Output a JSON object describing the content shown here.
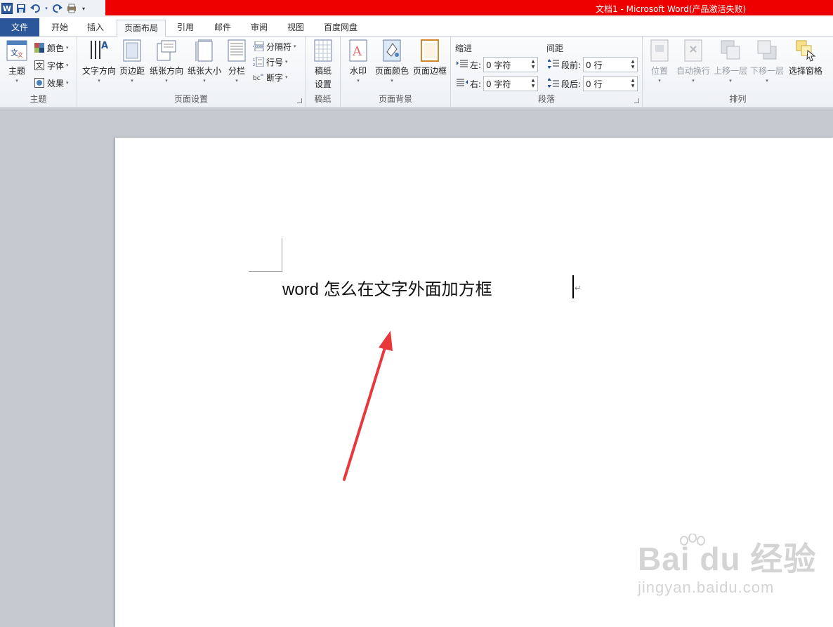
{
  "titlebar": {
    "title": "文档1 - Microsoft Word(产品激活失败)",
    "qat": {
      "word_logo": "W"
    }
  },
  "tabs": [
    {
      "label": "文件"
    },
    {
      "label": "开始"
    },
    {
      "label": "插入"
    },
    {
      "label": "页面布局"
    },
    {
      "label": "引用"
    },
    {
      "label": "邮件"
    },
    {
      "label": "审阅"
    },
    {
      "label": "视图"
    },
    {
      "label": "百度网盘"
    }
  ],
  "ribbon": {
    "theme": {
      "label": "主题",
      "theme_btn": "主题",
      "colors": "颜色",
      "fonts": "字体",
      "effects": "效果"
    },
    "page_setup": {
      "label": "页面设置",
      "text_direction": "文字方向",
      "margins": "页边距",
      "orientation": "纸张方向",
      "size": "纸张大小",
      "columns": "分栏",
      "breaks": "分隔符",
      "line_numbers": "行号",
      "hyphenation": "断字"
    },
    "manuscript": {
      "label": "稿纸",
      "settings_line1": "稿纸",
      "settings_line2": "设置"
    },
    "page_background": {
      "label": "页面背景",
      "watermark": "水印",
      "page_color": "页面颜色",
      "page_borders": "页面边框"
    },
    "paragraph": {
      "label": "段落",
      "indent_header": "缩进",
      "spacing_header": "间距",
      "left_label": "左:",
      "left_value": "0 字符",
      "right_label": "右:",
      "right_value": "0 字符",
      "before_label": "段前:",
      "before_value": "0 行",
      "after_label": "段后:",
      "after_value": "0 行"
    },
    "arrange": {
      "label": "排列",
      "position": "位置",
      "wrap_text": "自动换行",
      "bring_forward": "上移一层",
      "send_backward": "下移一层",
      "selection_pane": "选择窗格"
    }
  },
  "document": {
    "text_latin": "word ",
    "text_cn": "怎么在文字外面加方框"
  },
  "watermark": {
    "brand": "Bai du 经验",
    "url": "jingyan.baidu.com"
  },
  "colors": {
    "title_red": "#ee0000",
    "file_tab": "#2b579a",
    "arrow_red": "#e8383b"
  }
}
